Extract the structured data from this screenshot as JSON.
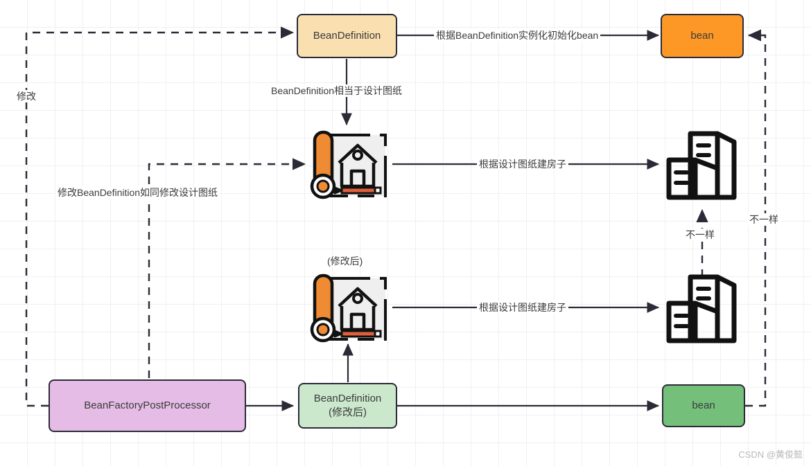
{
  "diagram": {
    "title": "Spring BeanFactoryPostProcessor BeanDefinition modification flow",
    "watermark": "CSDN @黄俊懿",
    "colors": {
      "peach": "#fadfb0",
      "orange": "#fd9827",
      "purple": "#e4bce6",
      "green_light": "#cbe8cd",
      "green": "#74c07b",
      "stroke": "#2b2b38",
      "grid": "#f0f0f0",
      "blueprint_roll": "#ef8b33",
      "blueprint_sheet": "#efefef",
      "pencil": "#e0603c"
    },
    "nodes": {
      "bean_definition_top": "BeanDefinition",
      "bean_top": "bean",
      "bean_factory_post_processor": "BeanFactoryPostProcessor",
      "bean_definition_modified_line1": "BeanDefinition",
      "bean_definition_modified_line2": "(修改后)",
      "bean_bottom": "bean"
    },
    "labels": {
      "instantiate_bean": "根据BeanDefinition实例化初始化bean",
      "blueprint_analogy": "BeanDefinition相当于设计图纸",
      "build_house_top": "根据设计图纸建房子",
      "build_house_bottom": "根据设计图纸建房子",
      "modify": "修改",
      "modify_blueprint_analogy": "修改BeanDefinition如同修改设计图纸",
      "modified_suffix": "(修改后)",
      "different_inner": "不一样",
      "different_outer": "不一样"
    },
    "icons": {
      "blueprint_top": "blueprint-icon",
      "blueprint_bottom": "blueprint-icon",
      "building_top": "building-icon",
      "building_bottom": "building-icon"
    }
  }
}
